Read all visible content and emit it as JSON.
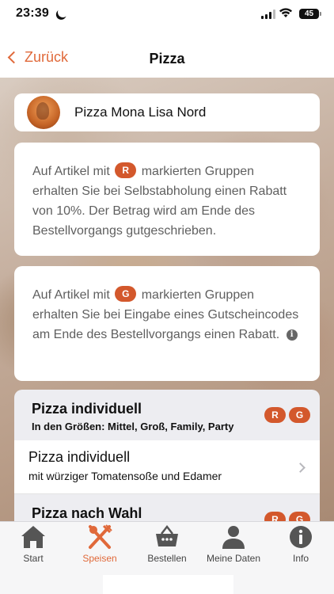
{
  "status_bar": {
    "time": "23:39",
    "battery": "45"
  },
  "nav": {
    "back_label": "Zurück",
    "title": "Pizza"
  },
  "restaurant": {
    "name": "Pizza Mona Lisa Nord"
  },
  "info_1": {
    "prefix": "Auf Artikel mit",
    "badge": "R",
    "text": "markierten Gruppen erhalten Sie bei Selbstabholung einen Rabatt von 10%. Der Betrag wird am Ende des Bestellvorgangs gutgeschrieben."
  },
  "info_2": {
    "prefix": "Auf Artikel mit",
    "badge": "G",
    "text": "markierten Gruppen erhalten Sie bei Eingabe eines Gutscheincodes am Ende des Bestellvorgangs einen Rabatt.",
    "icon": "i"
  },
  "sections": [
    {
      "title": "Pizza individuell",
      "subtitle": "In den Größen: Mittel, Groß, Family, Party",
      "badges": [
        "R",
        "G"
      ],
      "rows": [
        {
          "title": "Pizza individuell",
          "subtitle": "mit würziger Tomatensoße und Edamer"
        }
      ]
    },
    {
      "title": "Pizza nach Wahl",
      "badges": [
        "R",
        "G"
      ]
    }
  ],
  "tabs": [
    {
      "label": "Start",
      "icon": "home-icon",
      "active": false
    },
    {
      "label": "Speisen",
      "icon": "cutlery-icon",
      "active": true
    },
    {
      "label": "Bestellen",
      "icon": "basket-icon",
      "active": false
    },
    {
      "label": "Meine Daten",
      "icon": "person-icon",
      "active": false
    },
    {
      "label": "Info",
      "icon": "info-icon",
      "active": false
    }
  ],
  "colors": {
    "accent": "#e0693a",
    "badge": "#d3582c"
  }
}
